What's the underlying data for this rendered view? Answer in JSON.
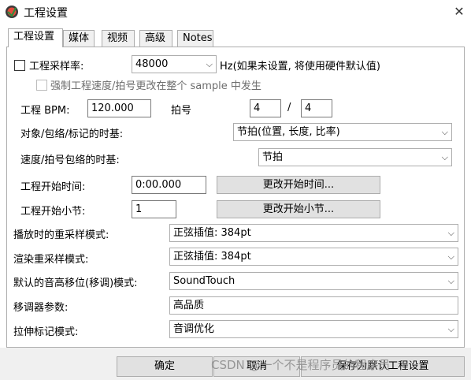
{
  "window": {
    "title": "工程设置"
  },
  "tabs": [
    "工程设置",
    "媒体",
    "视频",
    "高级",
    "Notes"
  ],
  "sample_rate": {
    "checkbox_label": "工程采样率:",
    "value": "48000",
    "note": "Hz(如果未设置, 将使用硬件默认值)",
    "force_label": "强制工程速度/拍号更改在整个 sample 中发生"
  },
  "bpm": {
    "label": "工程 BPM:",
    "value": "120.000"
  },
  "time_sig": {
    "label": "拍号",
    "num": "4",
    "sep": "/",
    "den": "4"
  },
  "timebase_items": {
    "label": "对象/包络/标记的时基:",
    "value": "节拍(位置, 长度, 比率)"
  },
  "timebase_tempo": {
    "label": "速度/拍号包络的时基:",
    "value": "节拍"
  },
  "start_time": {
    "label": "工程开始时间:",
    "value": "0:00.000",
    "button": "更改开始时间..."
  },
  "start_measure": {
    "label": "工程开始小节:",
    "value": "1",
    "button": "更改开始小节..."
  },
  "playback_resample": {
    "label": "播放时的重采样模式:",
    "value": "正弦插值: 384pt"
  },
  "render_resample": {
    "label": "渲染重采样模式:",
    "value": "正弦插值: 384pt"
  },
  "pitch_mode": {
    "label": "默认的音高移位(移调)模式:",
    "value": "SoundTouch"
  },
  "pitch_params": {
    "label": "移调器参数:",
    "value": "高品质"
  },
  "stretch_mode": {
    "label": "拉伸标记模式:",
    "value": "音调优化"
  },
  "footer": {
    "ok": "确定",
    "cancel": "取消",
    "save_default": "保存为默认工程设置",
    "watermark": "CSDN @一个不是程序员的程序员"
  }
}
